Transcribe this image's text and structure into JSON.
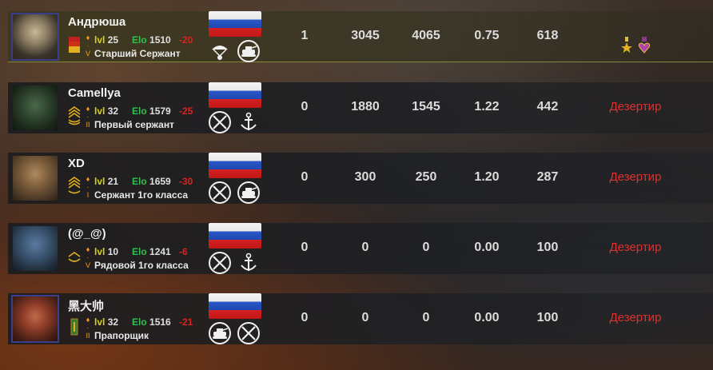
{
  "players": [
    {
      "name": "Андрюша",
      "lvl_label": "lvl",
      "lvl": "25",
      "elo_label": "Elo",
      "elo": "1510",
      "delta": "-20",
      "rank": "Старший Сержант",
      "kills": "1",
      "score": "3045",
      "damage": "4065",
      "ratio": "0.75",
      "points": "618",
      "status": "",
      "unit_icons": [
        "paratrooper-icon",
        "tank-icon"
      ],
      "medals": [
        "star-medal-icon",
        "purple-heart-medal-icon"
      ]
    },
    {
      "name": "Camellya",
      "lvl_label": "lvl",
      "lvl": "32",
      "elo_label": "Elo",
      "elo": "1579",
      "delta": "-25",
      "rank": "Первый сержант",
      "kills": "0",
      "score": "1880",
      "damage": "1545",
      "ratio": "1.22",
      "points": "442",
      "status": "Дезертир",
      "unit_icons": [
        "crossed-rifles-icon",
        "anchor-icon"
      ],
      "medals": []
    },
    {
      "name": "XD",
      "lvl_label": "lvl",
      "lvl": "21",
      "elo_label": "Elo",
      "elo": "1659",
      "delta": "-30",
      "rank": "Сержант 1го класса",
      "kills": "0",
      "score": "300",
      "damage": "250",
      "ratio": "1.20",
      "points": "287",
      "status": "Дезертир",
      "unit_icons": [
        "crossed-rifles-icon",
        "tank-icon"
      ],
      "medals": []
    },
    {
      "name": "(@_@)",
      "lvl_label": "lvl",
      "lvl": "10",
      "elo_label": "Elo",
      "elo": "1241",
      "delta": "-6",
      "rank": "Рядовой 1го класса",
      "kills": "0",
      "score": "0",
      "damage": "0",
      "ratio": "0.00",
      "points": "100",
      "status": "Дезертир",
      "unit_icons": [
        "crossed-rifles-icon",
        "anchor-icon"
      ],
      "medals": []
    },
    {
      "name": "黑大帅",
      "lvl_label": "lvl",
      "lvl": "32",
      "elo_label": "Elo",
      "elo": "1516",
      "delta": "-21",
      "rank": "Прапорщик",
      "kills": "0",
      "score": "0",
      "damage": "0",
      "ratio": "0.00",
      "points": "100",
      "status": "Дезертир",
      "unit_icons": [
        "tank-icon",
        "crossed-rifles-icon"
      ],
      "medals": []
    }
  ],
  "colors": {
    "lvl_label": "#d8d020",
    "elo_label": "#30c050",
    "delta": "#e02020",
    "status": "#e03030",
    "self_highlight": "#96a03c"
  }
}
